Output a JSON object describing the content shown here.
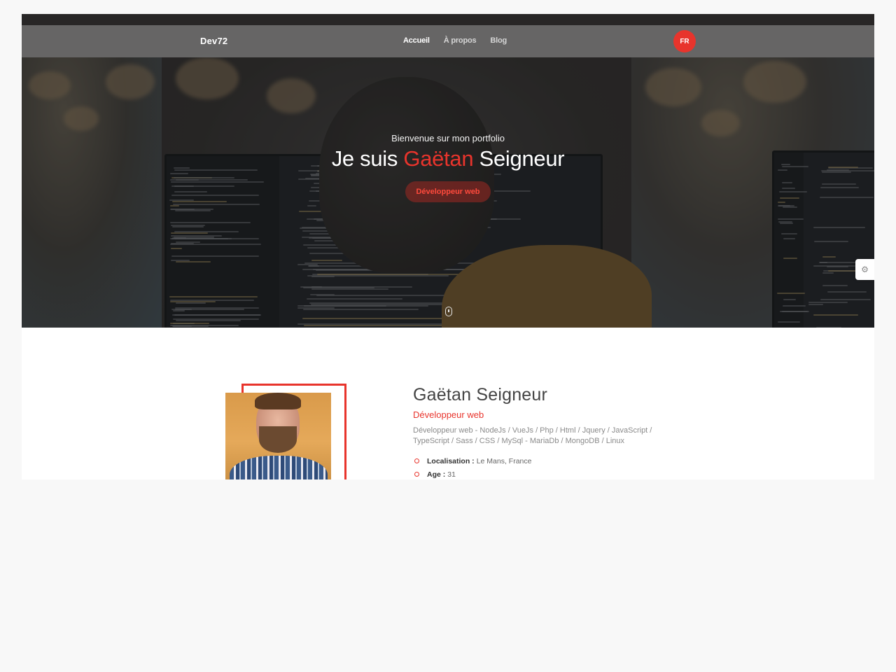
{
  "navbar": {
    "brand": "Dev72",
    "links": [
      {
        "label": "Accueil",
        "active": true
      },
      {
        "label": "À propos",
        "active": false
      },
      {
        "label": "Blog",
        "active": false
      }
    ],
    "language": "FR"
  },
  "hero": {
    "subtitle": "Bienvenue sur mon portfolio",
    "title_prefix": "Je suis ",
    "title_accent": "Gaëtan",
    "title_suffix": " Seigneur",
    "badge": "Développeur web",
    "scroll_icon": "mouse-icon",
    "settings_icon": "gear-icon"
  },
  "about": {
    "name": "Gaëtan Seigneur",
    "role": "Développeur web",
    "description": "Développeur web - NodeJs / VueJs / Php / Html / Jquery / JavaScript / TypeScript / Sass / CSS / MySql - MariaDb / MongoDB / Linux",
    "details": [
      {
        "label": "Localisation :",
        "value": "Le Mans, France"
      },
      {
        "label": "Age :",
        "value": "31"
      }
    ]
  },
  "colors": {
    "accent": "#e8342c",
    "navbar_bg": "#6e6e6e",
    "text_muted": "#8a8a8a"
  }
}
